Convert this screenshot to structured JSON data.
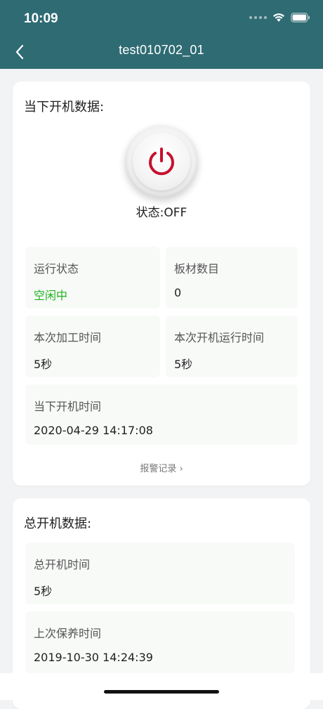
{
  "status_bar": {
    "time": "10:09"
  },
  "nav": {
    "title": "test010702_01",
    "back_icon": "chevron-left-icon"
  },
  "current": {
    "title": "当下开机数据:",
    "power_status": "状态:OFF",
    "power_icon": "power-icon",
    "power_color": "#c8102e",
    "cells": [
      {
        "label": "运行状态",
        "value": "空闲中",
        "value_color": "#1fb21f"
      },
      {
        "label": "板材数目",
        "value": "0"
      },
      {
        "label": "本次加工时间",
        "value": "5秒"
      },
      {
        "label": "本次开机运行时间",
        "value": "5秒"
      },
      {
        "label": "当下开机时间",
        "value": "2020-04-29 14:17:08"
      }
    ],
    "alarm_link": "报警记录 ›"
  },
  "total": {
    "title": "总开机数据:",
    "cells": [
      {
        "label": "总开机时间",
        "value": "5秒"
      },
      {
        "label": "上次保养时间",
        "value": "2019-10-30 14:24:39"
      }
    ]
  },
  "colors": {
    "header_bg": "#2f6b73",
    "page_bg": "#f2f3f5",
    "accent_green": "#1fb21f"
  }
}
